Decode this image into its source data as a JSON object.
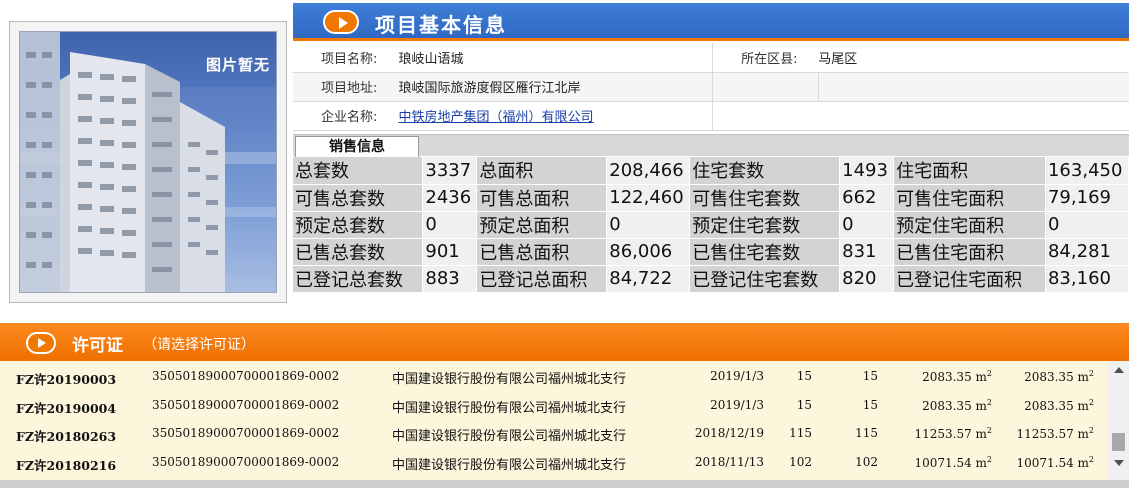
{
  "photo": {
    "placeholder_text": "图片暂无"
  },
  "basic_info": {
    "header": "项目基本信息",
    "project_name_label": "项目名称:",
    "project_name": "琅岐山语城",
    "district_label": "所在区县:",
    "district": "马尾区",
    "address_label": "项目地址:",
    "address": "琅岐国际旅游度假区雁行江北岸",
    "company_label": "企业名称:",
    "company": "中铁房地产集团（福州）有限公司"
  },
  "sales": {
    "tab_label": "销售信息",
    "rows": [
      [
        "总套数",
        "3337",
        "总面积",
        "208,466",
        "住宅套数",
        "1493",
        "住宅面积",
        "163,450"
      ],
      [
        "可售总套数",
        "2436",
        "可售总面积",
        "122,460",
        "可售住宅套数",
        "662",
        "可售住宅面积",
        "79,169"
      ],
      [
        "预定总套数",
        "0",
        "预定总面积",
        "0",
        "预定住宅套数",
        "0",
        "预定住宅面积",
        "0"
      ],
      [
        "已售总套数",
        "901",
        "已售总面积",
        "86,006",
        "已售住宅套数",
        "831",
        "已售住宅面积",
        "84,281"
      ],
      [
        "已登记总套数",
        "883",
        "已登记总面积",
        "84,722",
        "已登记住宅套数",
        "820",
        "已登记住宅面积",
        "83,160"
      ]
    ]
  },
  "permits": {
    "header": "许可证",
    "hint": "（请选择许可证）",
    "rows": [
      {
        "no": "FZ许20190003",
        "code": "35050189000700001869-0002",
        "bank": "中国建设银行股份有限公司福州城北支行",
        "date": "2019/1/3",
        "n1": "15",
        "n2": "15",
        "area1": "2083.35 m",
        "area2": "2083.35 m"
      },
      {
        "no": "FZ许20190004",
        "code": "35050189000700001869-0002",
        "bank": "中国建设银行股份有限公司福州城北支行",
        "date": "2019/1/3",
        "n1": "15",
        "n2": "15",
        "area1": "2083.35 m",
        "area2": "2083.35 m"
      },
      {
        "no": "FZ许20180263",
        "code": "35050189000700001869-0002",
        "bank": "中国建设银行股份有限公司福州城北支行",
        "date": "2018/12/19",
        "n1": "115",
        "n2": "115",
        "area1": "11253.57 m",
        "area2": "11253.57 m"
      },
      {
        "no": "FZ许20180216",
        "code": "35050189000700001869-0002",
        "bank": "中国建设银行股份有限公司福州城北支行",
        "date": "2018/11/13",
        "n1": "102",
        "n2": "102",
        "area1": "10071.54 m",
        "area2": "10071.54 m"
      }
    ],
    "area_superscript": "2"
  },
  "colors": {
    "blue_header": "#2f68c4",
    "orange_accent": "#f07800",
    "list_bg": "#fdf6dc"
  }
}
